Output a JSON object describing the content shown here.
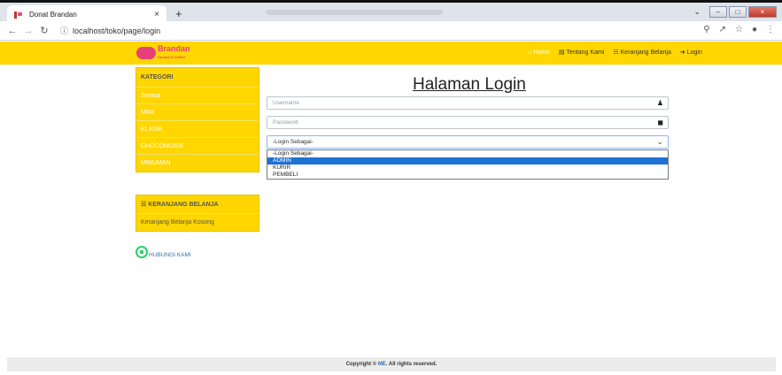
{
  "browser": {
    "tab_title": "Donat Brandan",
    "tab_close": "×",
    "new_tab": "+",
    "url": "localhost/toko/page/login"
  },
  "navbar": {
    "brand": "Brandan",
    "brand_sub": "Donuts & Coffee",
    "menu": [
      {
        "label": "Home",
        "icon": "home-icon"
      },
      {
        "label": "Tentang Kami",
        "icon": "id-card-icon"
      },
      {
        "label": "Keranjang Belanja",
        "icon": "cart-icon"
      },
      {
        "label": "Login",
        "icon": "login-icon"
      }
    ]
  },
  "sidebar": {
    "kategori_title": "KATEGORI",
    "kategori": [
      "Semua",
      "MINI",
      "KLASIK",
      "CHOCOMOISE",
      "MINUMAN"
    ],
    "cart_title": "KERANJANG BELANJA",
    "cart_empty": "Keranjang Belanja Kosong",
    "contact": "HUBUNGI KAMI"
  },
  "login": {
    "title": "Halaman Login",
    "username_placeholder": "Username",
    "password_placeholder": "Password",
    "select_value": "-Login Sebagai-",
    "options": [
      "-Login Sebagai-",
      "ADMIN",
      "KURIR",
      "PEMBELI"
    ],
    "selected_option": "ADMIN"
  },
  "footer": {
    "prefix": "Copyright © ",
    "brand": "ME",
    "suffix": ". All rights reserved."
  }
}
